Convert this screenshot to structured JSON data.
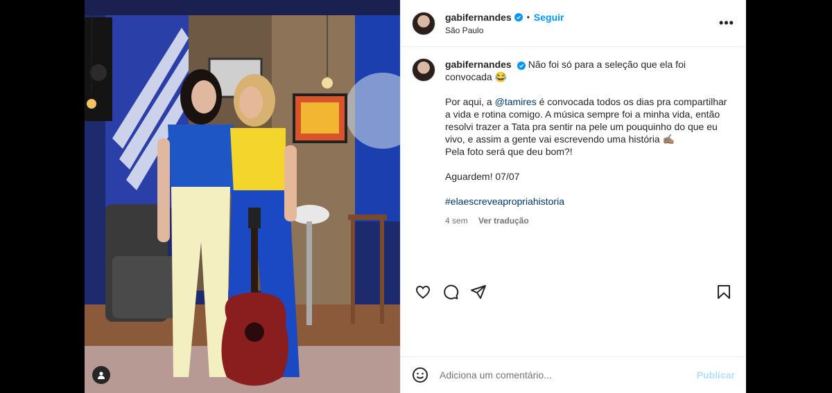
{
  "header": {
    "username": "gabifernandes",
    "separator": "•",
    "follow_label": "Seguir",
    "location": "São Paulo",
    "more_label": "•••"
  },
  "caption": {
    "username": "gabifernandes",
    "line1": "Não foi só para a seleção que ela foi convocada 😂",
    "p2_before": "Por aqui, a ",
    "mention": "@tamires",
    "p2_after": " é convocada todos os dias pra compartilhar a vida e rotina comigo. A música sempre foi a minha vida, então resolvi trazer a Tata pra sentir na pele um pouquinho do que eu vivo, e assim a gente vai escrevendo uma história ✍🏽",
    "p2_last": "Pela foto será que deu bom?!",
    "p3": "Aguardem! 07/07",
    "hashtag": "#elaescreveapropriahistoria",
    "time": "4 sem",
    "translate": "Ver tradução"
  },
  "comment_box": {
    "placeholder": "Adiciona um comentário...",
    "publish_label": "Publicar"
  },
  "colors": {
    "accent": "#0095f6",
    "link": "#00376b",
    "publish_disabled": "#b2dffc"
  },
  "icons": [
    "verified-badge-icon",
    "more-options-icon",
    "heart-icon",
    "comment-icon",
    "share-icon",
    "bookmark-icon",
    "emoji-icon",
    "user-tag-icon"
  ]
}
